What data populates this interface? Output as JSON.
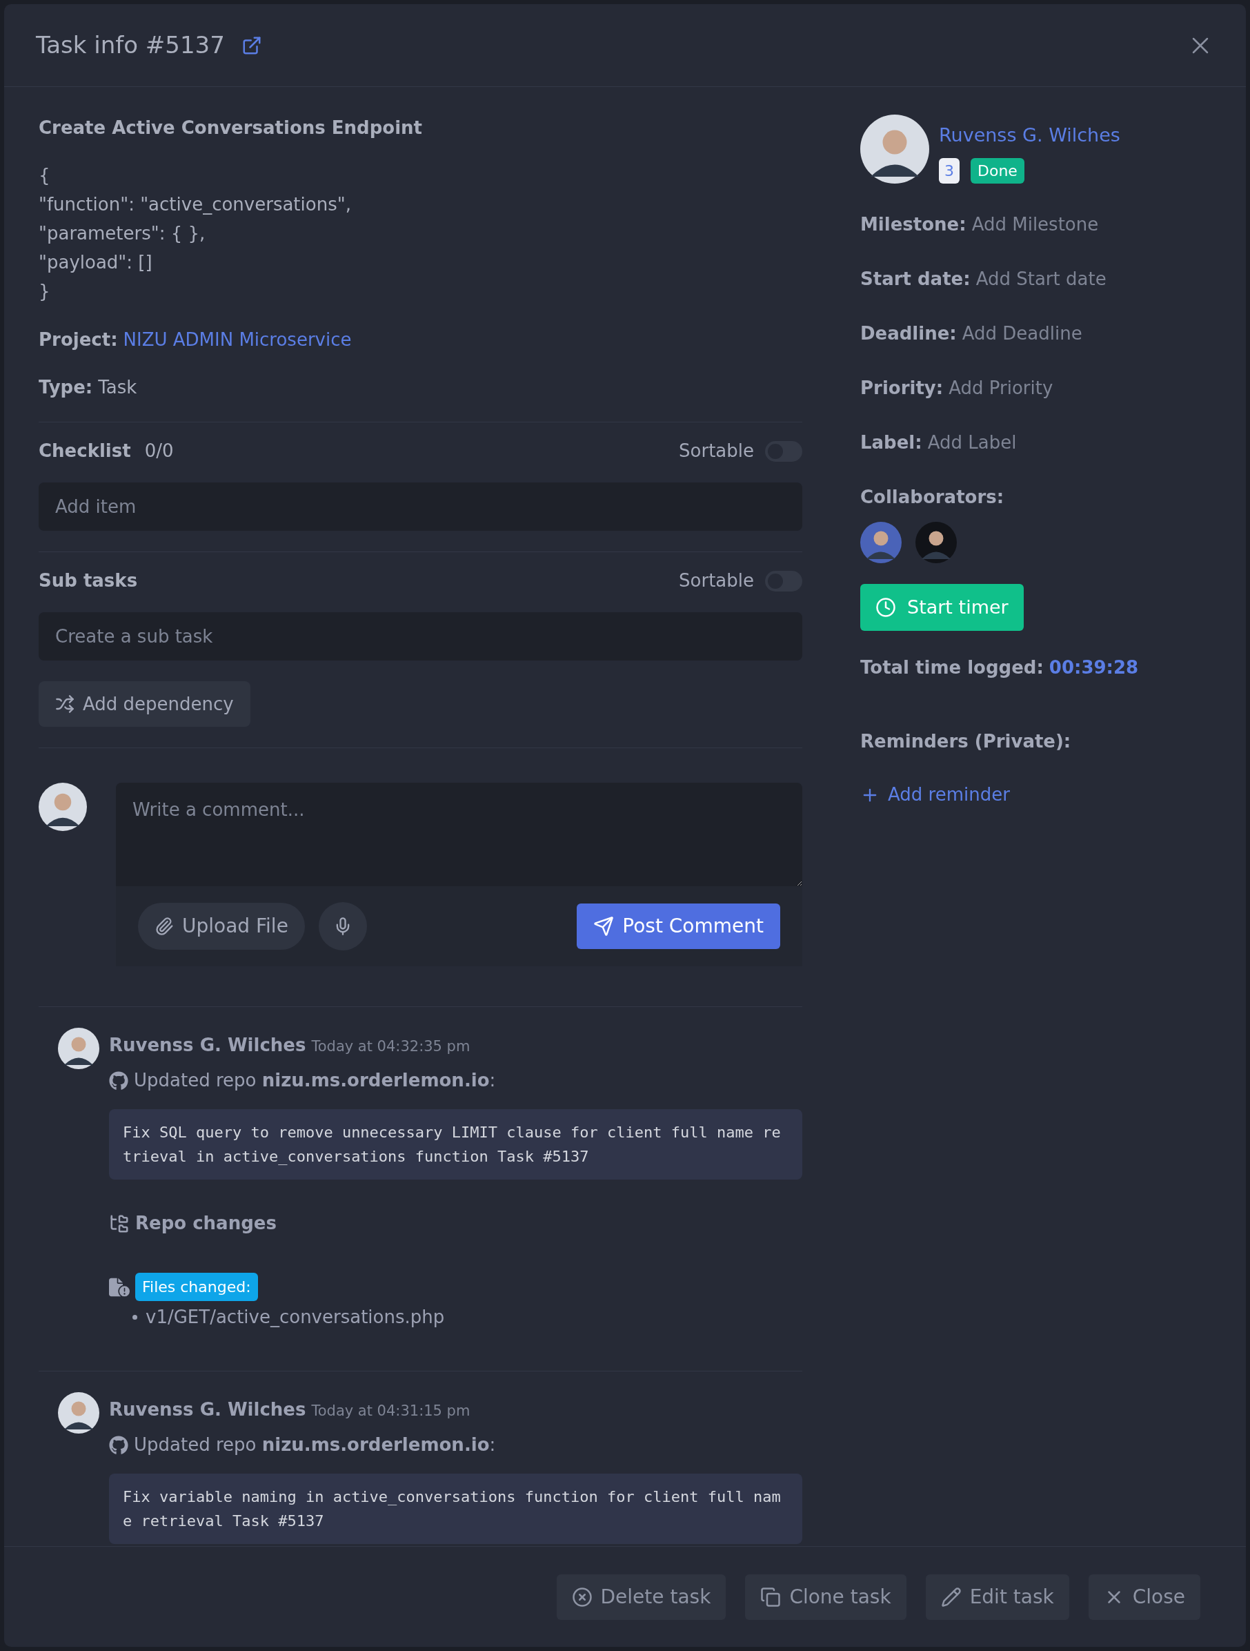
{
  "header": {
    "title": "Task info #5137"
  },
  "task": {
    "title": "Create Active Conversations Endpoint",
    "description_lines": [
      "{",
      "\"function\": \"active_conversations\",",
      "\"parameters\": { },",
      "\"payload\": []",
      "}"
    ],
    "fields": [
      {
        "label": "Project:",
        "value": "NIZU ADMIN Microservice",
        "kind": "link"
      },
      {
        "label": "Type:",
        "value": "Task",
        "kind": "text"
      }
    ]
  },
  "checklist": {
    "title": "Checklist",
    "count": "0/0",
    "sortable": {
      "label": "Sortable",
      "on": false
    },
    "placeholder": "Add item"
  },
  "subtasks": {
    "title": "Sub tasks",
    "sortable": {
      "label": "Sortable",
      "on": false
    },
    "placeholder": "Create a sub task"
  },
  "add_dependency": "Add dependency",
  "comment_form": {
    "placeholder": "Write a comment...",
    "upload": "Upload File",
    "post": "Post Comment"
  },
  "activity": [
    {
      "author": "Ruvenss G. Wilches",
      "time": "Today at 04:32:35 pm",
      "action": "Updated repo **nizu.ms.orderlemon.io**:",
      "message": "Fix SQL query to remove unnecessary LIMIT clause for client full name retrieval in active_conversations function Task #5137",
      "repo_changes": "Repo changes",
      "files_label": "Files changed:",
      "files": [
        "v1/GET/active_conversations.php"
      ]
    },
    {
      "author": "Ruvenss G. Wilches",
      "time": "Today at 04:31:15 pm",
      "action": "Updated repo **nizu.ms.orderlemon.io**:",
      "message": "Fix variable naming in active_conversations function for client full name retrieval Task #5137"
    }
  ],
  "sidebar": {
    "assignee": {
      "name": "Ruvenss G. Wilches",
      "count": "3",
      "status": "Done"
    },
    "fields": [
      {
        "label": "Milestone:",
        "value": "Add Milestone"
      },
      {
        "label": "Start date:",
        "value": "Add Start date"
      },
      {
        "label": "Deadline:",
        "value": "Add Deadline"
      },
      {
        "label": "Priority:",
        "value": "Add Priority"
      },
      {
        "label": "Label:",
        "value": "Add Label"
      }
    ],
    "collaborators_label": "Collaborators:",
    "timer": "Start timer",
    "total_label": "Total time logged:",
    "total_value": "00:39:28",
    "reminders_label": "Reminders (Private):",
    "add_reminder": "Add reminder"
  },
  "footer": {
    "buttons": [
      {
        "kind": "delete",
        "label": "Delete task"
      },
      {
        "kind": "clone",
        "label": "Clone task"
      },
      {
        "kind": "edit",
        "label": "Edit task"
      },
      {
        "kind": "close",
        "label": "Close"
      }
    ]
  }
}
